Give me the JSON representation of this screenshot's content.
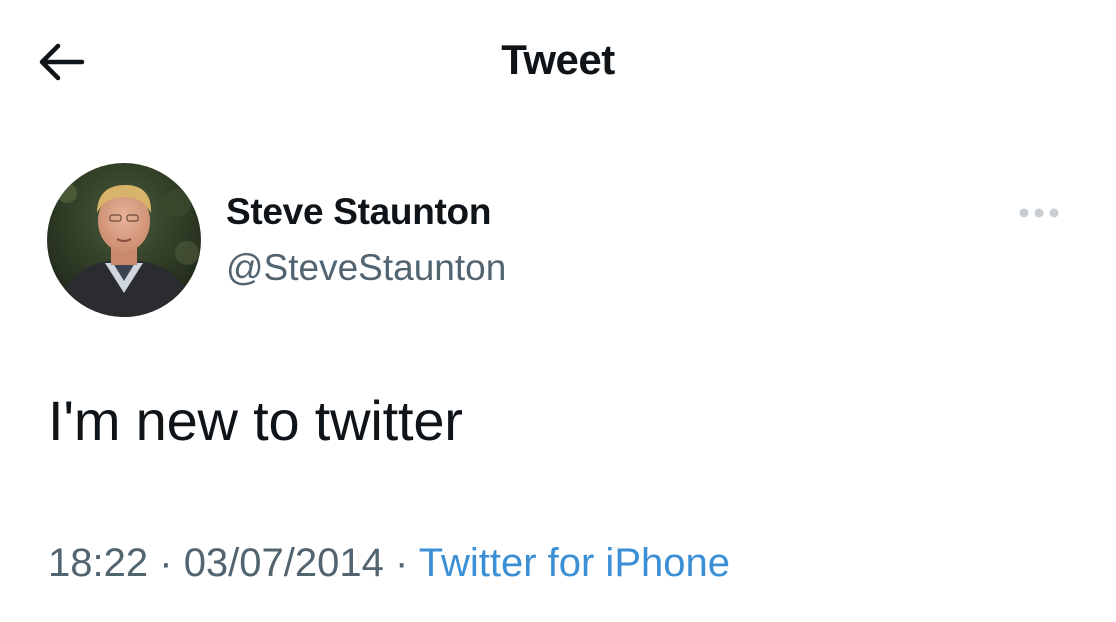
{
  "header": {
    "title": "Tweet",
    "back_icon": "arrow-left-icon"
  },
  "tweet": {
    "author_name": "Steve Staunton",
    "author_handle": "@SteveStaunton",
    "avatar_icon": "avatar-photo",
    "more_icon": "more-horizontal-icon",
    "text": "I'm new to twitter",
    "time": "18:22",
    "separator": "·",
    "date": "03/07/2014",
    "source": "Twitter for iPhone"
  },
  "colors": {
    "text_primary": "#0f1419",
    "text_secondary": "#536471",
    "link": "#3b8fd4",
    "more_icon": "#c9ced3"
  }
}
